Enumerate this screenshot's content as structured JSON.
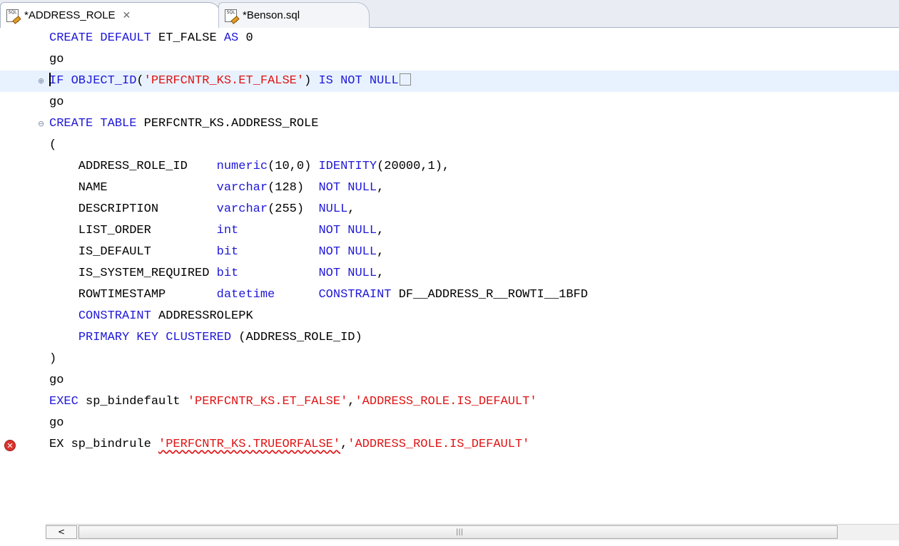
{
  "tabs": [
    {
      "label": "*ADDRESS_ROLE",
      "icon": "sql-file-icon",
      "active": true,
      "close_glyph": "✕"
    },
    {
      "label": "*Benson.sql",
      "icon": "sql-file-icon",
      "active": false
    }
  ],
  "icon_text": "SQL",
  "editor": {
    "lines": [
      "CREATE DEFAULT ET_FALSE AS 0",
      "go",
      "IF OBJECT_ID('PERFCNTR_KS.ET_FALSE') IS NOT NULL",
      "go",
      "CREATE TABLE PERFCNTR_KS.ADDRESS_ROLE",
      "(",
      "    ADDRESS_ROLE_ID    numeric(10,0) IDENTITY(20000,1),",
      "    NAME               varchar(128)  NOT NULL,",
      "    DESCRIPTION        varchar(255)  NULL,",
      "    LIST_ORDER         int           NOT NULL,",
      "    IS_DEFAULT         bit           NOT NULL,",
      "    IS_SYSTEM_REQUIRED bit           NOT NULL,",
      "    ROWTIMESTAMP       datetime      CONSTRAINT DF__ADDRESS_R__ROWTI__1BFD",
      "    CONSTRAINT ADDRESSROLEPK",
      "    PRIMARY KEY CLUSTERED (ADDRESS_ROLE_ID)",
      ")",
      "go",
      "EXEC sp_bindefault 'PERFCNTR_KS.ET_FALSE','ADDRESS_ROLE.IS_DEFAULT'",
      "go",
      "EX sp_bindrule 'PERFCNTR_KS.TRUEORFALSE','ADDRESS_ROLE.IS_DEFAULT'"
    ]
  },
  "fold_markers": {
    "expand": "⊕",
    "collapse": "⊖"
  },
  "error_marker": "✕",
  "scrollbar": {
    "left_arrow": "<",
    "grip": "|||"
  },
  "colors": {
    "keyword": "#1f18d8",
    "string": "#e01414",
    "current_line": "#e8f2fe"
  }
}
